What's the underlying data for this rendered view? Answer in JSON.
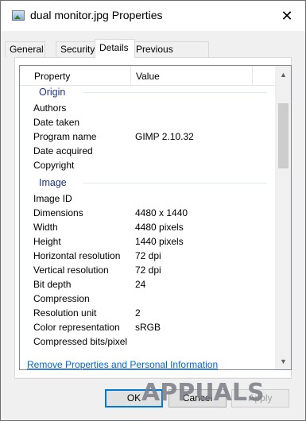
{
  "window": {
    "title": "dual monitor.jpg Properties",
    "close_label": "✕"
  },
  "tabs": [
    {
      "label": "General"
    },
    {
      "label": "Security"
    },
    {
      "label": "Details",
      "active": true
    },
    {
      "label": "Previous Versions"
    }
  ],
  "details": {
    "columns": {
      "property": "Property",
      "value": "Value"
    },
    "groups": [
      {
        "name": "Origin",
        "rows": [
          {
            "name": "Authors",
            "value": ""
          },
          {
            "name": "Date taken",
            "value": ""
          },
          {
            "name": "Program name",
            "value": "GIMP 2.10.32"
          },
          {
            "name": "Date acquired",
            "value": ""
          },
          {
            "name": "Copyright",
            "value": ""
          }
        ]
      },
      {
        "name": "Image",
        "rows": [
          {
            "name": "Image ID",
            "value": ""
          },
          {
            "name": "Dimensions",
            "value": "4480 x 1440"
          },
          {
            "name": "Width",
            "value": "4480 pixels"
          },
          {
            "name": "Height",
            "value": "1440 pixels"
          },
          {
            "name": "Horizontal resolution",
            "value": "72 dpi"
          },
          {
            "name": "Vertical resolution",
            "value": "72 dpi"
          },
          {
            "name": "Bit depth",
            "value": "24"
          },
          {
            "name": "Compression",
            "value": ""
          },
          {
            "name": "Resolution unit",
            "value": "2"
          },
          {
            "name": "Color representation",
            "value": "sRGB"
          },
          {
            "name": "Compressed bits/pixel",
            "value": ""
          }
        ]
      }
    ]
  },
  "remove_link": "Remove Properties and Personal Information",
  "buttons": {
    "ok": "OK",
    "cancel": "Cancel",
    "apply": "Apply"
  },
  "watermark": "APPUALS",
  "colors": {
    "link": "#0066cc",
    "group_header": "#1e3287",
    "default_button_border": "#0078d7"
  }
}
